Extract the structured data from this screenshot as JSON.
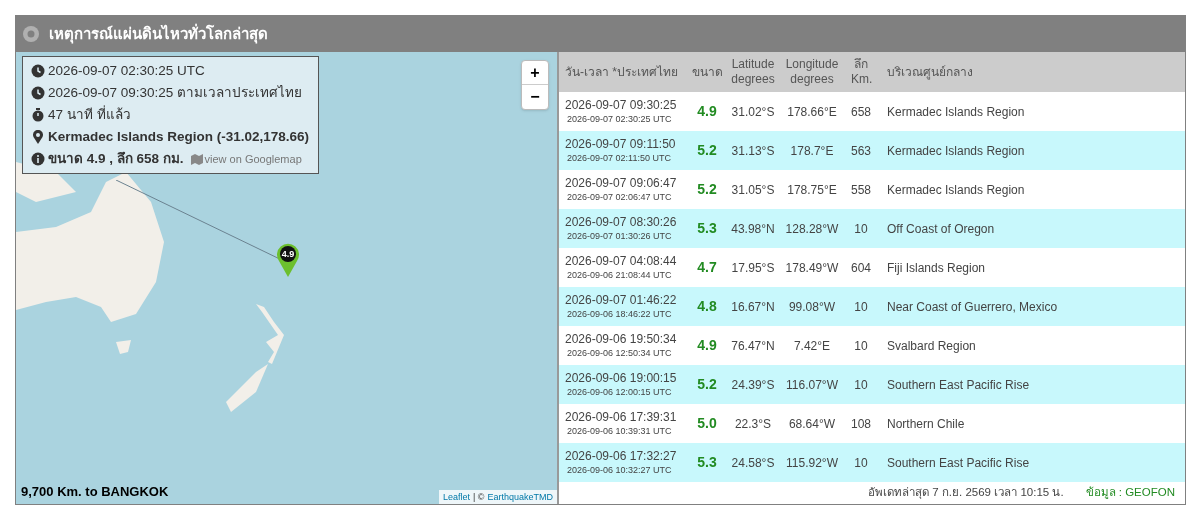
{
  "panel": {
    "title": "เหตุการณ์แผ่นดินไหวทั่วโลกล่าสุด"
  },
  "map": {
    "zoom_in": "+",
    "zoom_out": "−",
    "info": [
      {
        "kind": "clock",
        "text": "2026-09-07 02:30:25 UTC"
      },
      {
        "kind": "clock",
        "text": "2026-09-07 09:30:25 ตามเวลาประเทศไทย"
      },
      {
        "kind": "timer",
        "text": "47 นาที ที่แล้ว"
      },
      {
        "kind": "pin",
        "text": "Kermadec Islands Region (-31.02,178.66)"
      },
      {
        "kind": "info",
        "text": "ขนาด 4.9 , ลึก 658 กม.",
        "link": "view on Googlemap"
      }
    ],
    "marker": "4.9",
    "distance": "9,700 Km. to BANGKOK",
    "attribution_link": "Leaflet",
    "attribution_separator": "| ©",
    "attribution_source": "EarthquakeTMD"
  },
  "table": {
    "columns": [
      "วัน-เวลา *ประเทศไทย",
      "ขนาด",
      "Latitude degrees",
      "Longitude degrees",
      "ลึก Km.",
      "บริเวณศูนย์กลาง"
    ],
    "rows": [
      {
        "local": "2026-09-07 09:30:25",
        "utc": "2026-09-07 02:30:25 UTC",
        "mag": "4.9",
        "lat": "31.02°S",
        "lon": "178.66°E",
        "depth": "658",
        "region": "Kermadec Islands Region"
      },
      {
        "local": "2026-09-07 09:11:50",
        "utc": "2026-09-07 02:11:50 UTC",
        "mag": "5.2",
        "lat": "31.13°S",
        "lon": "178.7°E",
        "depth": "563",
        "region": "Kermadec Islands Region"
      },
      {
        "local": "2026-09-07 09:06:47",
        "utc": "2026-09-07 02:06:47 UTC",
        "mag": "5.2",
        "lat": "31.05°S",
        "lon": "178.75°E",
        "depth": "558",
        "region": "Kermadec Islands Region"
      },
      {
        "local": "2026-09-07 08:30:26",
        "utc": "2026-09-07 01:30:26 UTC",
        "mag": "5.3",
        "lat": "43.98°N",
        "lon": "128.28°W",
        "depth": "10",
        "region": "Off Coast of Oregon"
      },
      {
        "local": "2026-09-07 04:08:44",
        "utc": "2026-09-06 21:08:44 UTC",
        "mag": "4.7",
        "lat": "17.95°S",
        "lon": "178.49°W",
        "depth": "604",
        "region": "Fiji Islands Region"
      },
      {
        "local": "2026-09-07 01:46:22",
        "utc": "2026-09-06 18:46:22 UTC",
        "mag": "4.8",
        "lat": "16.67°N",
        "lon": "99.08°W",
        "depth": "10",
        "region": "Near Coast of Guerrero, Mexico"
      },
      {
        "local": "2026-09-06 19:50:34",
        "utc": "2026-09-06 12:50:34 UTC",
        "mag": "4.9",
        "lat": "76.47°N",
        "lon": "7.42°E",
        "depth": "10",
        "region": "Svalbard Region"
      },
      {
        "local": "2026-09-06 19:00:15",
        "utc": "2026-09-06 12:00:15 UTC",
        "mag": "5.2",
        "lat": "24.39°S",
        "lon": "116.07°W",
        "depth": "10",
        "region": "Southern East Pacific Rise"
      },
      {
        "local": "2026-09-06 17:39:31",
        "utc": "2026-09-06 10:39:31 UTC",
        "mag": "5.0",
        "lat": "22.3°S",
        "lon": "68.64°W",
        "depth": "108",
        "region": "Northern Chile"
      },
      {
        "local": "2026-09-06 17:32:27",
        "utc": "2026-09-06 10:32:27 UTC",
        "mag": "5.3",
        "lat": "24.58°S",
        "lon": "115.92°W",
        "depth": "10",
        "region": "Southern East Pacific Rise"
      }
    ]
  },
  "footer": {
    "updated": "อัพเดทล่าสุด 7 ก.ย. 2569 เวลา 10:15 น.",
    "source": "ข้อมูล : GEOFON"
  }
}
